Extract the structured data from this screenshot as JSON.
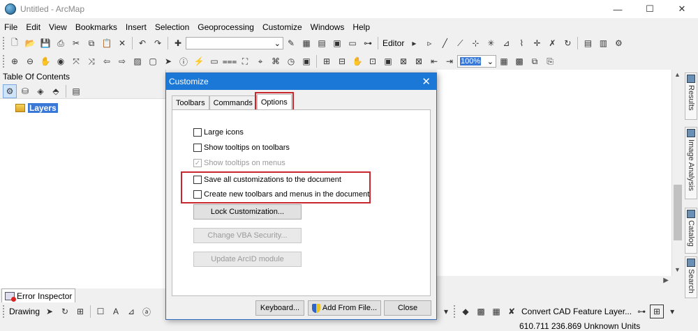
{
  "window": {
    "title": "Untitled - ArcMap",
    "minimize": "—",
    "maximize": "☐",
    "close": "✕"
  },
  "menubar": [
    "File",
    "Edit",
    "View",
    "Bookmarks",
    "Insert",
    "Selection",
    "Geoprocessing",
    "Customize",
    "Windows",
    "Help"
  ],
  "toolbar": {
    "editor_label": "Editor",
    "zoom_level": "100%"
  },
  "toc": {
    "title": "Table Of Contents",
    "layers_label": "Layers"
  },
  "side_tabs": [
    "Results",
    "Image Analysis",
    "Catalog",
    "Search"
  ],
  "dialog": {
    "title": "Customize",
    "tabs": [
      "Toolbars",
      "Commands",
      "Options"
    ],
    "active_tab": "Options",
    "options": [
      {
        "label": "Large icons",
        "checked": false,
        "enabled": true
      },
      {
        "label": "Show tooltips on toolbars",
        "checked": false,
        "enabled": true
      },
      {
        "label": "Show tooltips on menus",
        "checked": true,
        "enabled": false
      },
      {
        "label": "Save all customizations to the document",
        "checked": false,
        "enabled": true
      },
      {
        "label": "Create new toolbars and menus in the document",
        "checked": false,
        "enabled": true
      }
    ],
    "buttons": {
      "lock": "Lock Customization...",
      "vba": "Change VBA Security...",
      "arcid": "Update ArcID module"
    },
    "footer": {
      "keyboard": "Keyboard...",
      "add_from_file": "Add From File...",
      "close": "Close"
    }
  },
  "error_inspector": "Error Inspector",
  "drawing_label": "Drawing",
  "bottom_tool_label": "Convert CAD Feature Layer...",
  "status": {
    "coordinates": "610.711  236.869 Unknown Units"
  },
  "colors": {
    "dialog_title_bg": "#1c78d6",
    "highlight": "#c9262e",
    "selection": "#3a78d8"
  }
}
